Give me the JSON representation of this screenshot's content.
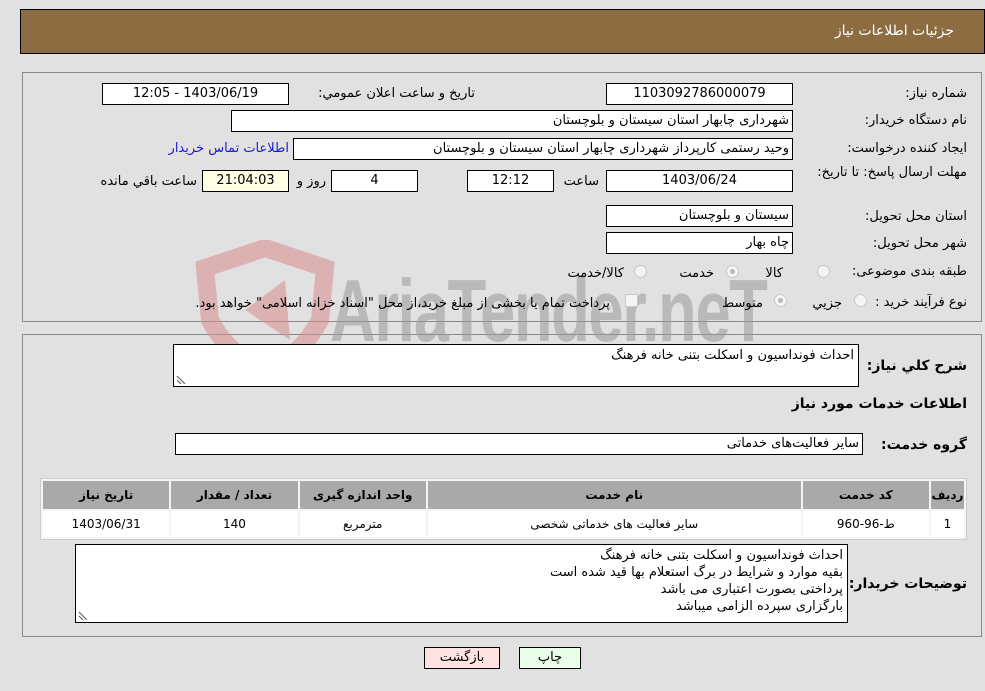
{
  "header": {
    "title": "جزئيات اطلاعات نياز"
  },
  "watermark": {
    "text": "AriaTender.neT",
    "shield_color": "#d98a8a"
  },
  "details": {
    "need_number_label": "شماره نياز:",
    "need_number": "1103092786000079",
    "announce_label": "تاريخ و ساعت اعلان عمومي:",
    "announce_value": "1403/06/19 - 12:05",
    "buyer_org_label": "نام دستگاه خريدار:",
    "buyer_org": "شهرداری چابهار استان سیستان و بلوچستان",
    "requester_label": "ايجاد کننده درخواست:",
    "requester": "وحید رستمی کارپرداز شهرداری چابهار استان سیستان و بلوچستان",
    "buyer_contact_link": "اطلاعات تماس خريدار",
    "deadline_label": "مهلت ارسال پاسخ: تا تاريخ:",
    "deadline_date": "1403/06/24",
    "time_label": "ساعت",
    "deadline_time": "12:12",
    "days_value": "4",
    "days_label": "روز و",
    "remaining_time": "21:04:03",
    "remaining_label": "ساعت باقي مانده",
    "province_label": "استان محل تحويل:",
    "province": "سیستان و بلوچستان",
    "city_label": "شهر محل تحويل:",
    "city": "چاه بهار",
    "category_label": "طبقه بندی موضوعی:",
    "category_options": [
      {
        "label": "کالا",
        "checked": false
      },
      {
        "label": "خدمت",
        "checked": true
      },
      {
        "label": "کالا/خدمت",
        "checked": false
      }
    ],
    "process_label": "نوع فرآيند خريد :",
    "process_options": [
      {
        "label": "جزيي",
        "checked": false
      },
      {
        "label": "متوسط",
        "checked": true
      }
    ],
    "treasury_checkbox_label": "پرداخت تمام يا بخشی از مبلغ خريد،از محل \"اسناد خزانه اسلامی\" خواهد بود.",
    "treasury_checked": false
  },
  "summary": {
    "description_label": "شرح کلي نياز:",
    "description": "احداث فونداسیون و اسکلت بتنی خانه فرهنگ",
    "services_heading": "اطلاعات خدمات مورد نياز",
    "service_group_label": "گروه خدمت:",
    "service_group": "ساير فعاليت‌هاى خدماتى"
  },
  "table": {
    "headers": [
      "رديف",
      "کد خدمت",
      "نام خدمت",
      "واحد اندازه گيری",
      "تعداد / مقدار",
      "تاريخ نياز"
    ],
    "rows": [
      [
        "1",
        "ط-96-960",
        "ساير فعاليت هاى خدماتى شخصى",
        "مترمربع",
        "140",
        "1403/06/31"
      ]
    ]
  },
  "buyer_notes": {
    "label": "توضيحات خريدار:",
    "lines": [
      "احداث فونداسیون و اسکلت بتنی خانه فرهنگ",
      "بقیه موارد و شرایط در برگ استعلام بها قید شده است",
      "پرداختی بصورت اعتباری می باشد",
      "بارگزاری سپرده الزامی میباشد"
    ]
  },
  "buttons": {
    "print": "چاپ",
    "back": "بازگشت"
  }
}
